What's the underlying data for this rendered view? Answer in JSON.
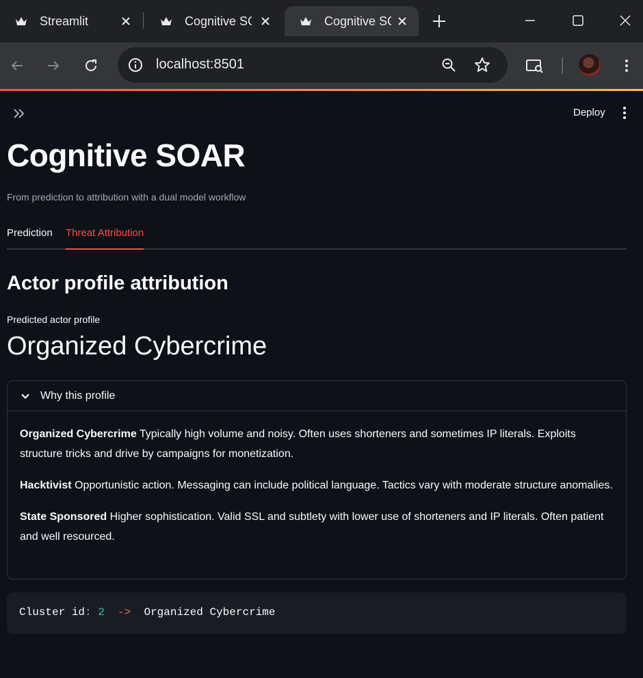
{
  "browser": {
    "tabs": [
      {
        "title": "Streamlit",
        "active": false
      },
      {
        "title": "Cognitive SOAR",
        "active": false
      },
      {
        "title": "Cognitive SOAR",
        "active": true
      }
    ],
    "url": "localhost:8501"
  },
  "app": {
    "deploy_label": "Deploy",
    "title": "Cognitive SOAR",
    "subtitle": "From prediction to attribution with a dual model workflow",
    "tabs": [
      {
        "label": "Prediction",
        "active": false
      },
      {
        "label": "Threat Attribution",
        "active": true
      }
    ],
    "section_heading": "Actor profile attribution",
    "metric": {
      "label": "Predicted actor profile",
      "value": "Organized Cybercrime"
    },
    "expander": {
      "label": "Why this profile",
      "expanded": true,
      "profiles": [
        {
          "name": "Organized Cybercrime",
          "description": "Typically high volume and noisy. Often uses shorteners and sometimes IP literals. Exploits structure tricks and drive by campaigns for monetization."
        },
        {
          "name": "Hacktivist",
          "description": "Opportunistic action. Messaging can include political language. Tactics vary with moderate structure anomalies."
        },
        {
          "name": "State Sponsored",
          "description": "Higher sophistication. Valid SSL and subtlety with lower use of shorteners and IP literals. Often patient and well resourced."
        }
      ]
    },
    "code": {
      "key": "Cluster id",
      "colon": ":",
      "value": "2",
      "arrow": "->",
      "result": "Organized Cybercrime"
    }
  },
  "colors": {
    "accent": "#ff4b4b",
    "background": "#0e1117",
    "number": "#2fc6b4",
    "arrow": "#e8743b"
  }
}
